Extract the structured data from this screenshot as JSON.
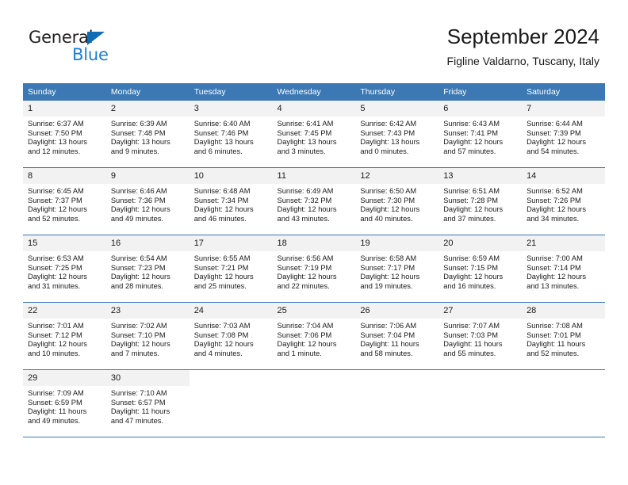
{
  "brand": {
    "name_top": "General",
    "name_bottom": "Blue",
    "triangle_color": "#0f6cb5",
    "blue_text_color": "#1b7fd4"
  },
  "header": {
    "title": "September 2024",
    "subtitle": "Figline Valdarno, Tuscany, Italy"
  },
  "theme": {
    "header_row_bg": "#3b78b4",
    "daynum_bg": "#f2f2f2",
    "border_color": "#3b78b4",
    "text_color": "#1a1a1a"
  },
  "weekday_headers": [
    "Sunday",
    "Monday",
    "Tuesday",
    "Wednesday",
    "Thursday",
    "Friday",
    "Saturday"
  ],
  "labels": {
    "sunrise_prefix": "Sunrise:",
    "sunset_prefix": "Sunset:",
    "daylight_prefix": "Daylight:"
  },
  "weeks": [
    [
      {
        "day": "1",
        "sunrise": "Sunrise: 6:37 AM",
        "sunset": "Sunset: 7:50 PM",
        "daylight_line1": "Daylight: 13 hours",
        "daylight_line2": "and 12 minutes."
      },
      {
        "day": "2",
        "sunrise": "Sunrise: 6:39 AM",
        "sunset": "Sunset: 7:48 PM",
        "daylight_line1": "Daylight: 13 hours",
        "daylight_line2": "and 9 minutes."
      },
      {
        "day": "3",
        "sunrise": "Sunrise: 6:40 AM",
        "sunset": "Sunset: 7:46 PM",
        "daylight_line1": "Daylight: 13 hours",
        "daylight_line2": "and 6 minutes."
      },
      {
        "day": "4",
        "sunrise": "Sunrise: 6:41 AM",
        "sunset": "Sunset: 7:45 PM",
        "daylight_line1": "Daylight: 13 hours",
        "daylight_line2": "and 3 minutes."
      },
      {
        "day": "5",
        "sunrise": "Sunrise: 6:42 AM",
        "sunset": "Sunset: 7:43 PM",
        "daylight_line1": "Daylight: 13 hours",
        "daylight_line2": "and 0 minutes."
      },
      {
        "day": "6",
        "sunrise": "Sunrise: 6:43 AM",
        "sunset": "Sunset: 7:41 PM",
        "daylight_line1": "Daylight: 12 hours",
        "daylight_line2": "and 57 minutes."
      },
      {
        "day": "7",
        "sunrise": "Sunrise: 6:44 AM",
        "sunset": "Sunset: 7:39 PM",
        "daylight_line1": "Daylight: 12 hours",
        "daylight_line2": "and 54 minutes."
      }
    ],
    [
      {
        "day": "8",
        "sunrise": "Sunrise: 6:45 AM",
        "sunset": "Sunset: 7:37 PM",
        "daylight_line1": "Daylight: 12 hours",
        "daylight_line2": "and 52 minutes."
      },
      {
        "day": "9",
        "sunrise": "Sunrise: 6:46 AM",
        "sunset": "Sunset: 7:36 PM",
        "daylight_line1": "Daylight: 12 hours",
        "daylight_line2": "and 49 minutes."
      },
      {
        "day": "10",
        "sunrise": "Sunrise: 6:48 AM",
        "sunset": "Sunset: 7:34 PM",
        "daylight_line1": "Daylight: 12 hours",
        "daylight_line2": "and 46 minutes."
      },
      {
        "day": "11",
        "sunrise": "Sunrise: 6:49 AM",
        "sunset": "Sunset: 7:32 PM",
        "daylight_line1": "Daylight: 12 hours",
        "daylight_line2": "and 43 minutes."
      },
      {
        "day": "12",
        "sunrise": "Sunrise: 6:50 AM",
        "sunset": "Sunset: 7:30 PM",
        "daylight_line1": "Daylight: 12 hours",
        "daylight_line2": "and 40 minutes."
      },
      {
        "day": "13",
        "sunrise": "Sunrise: 6:51 AM",
        "sunset": "Sunset: 7:28 PM",
        "daylight_line1": "Daylight: 12 hours",
        "daylight_line2": "and 37 minutes."
      },
      {
        "day": "14",
        "sunrise": "Sunrise: 6:52 AM",
        "sunset": "Sunset: 7:26 PM",
        "daylight_line1": "Daylight: 12 hours",
        "daylight_line2": "and 34 minutes."
      }
    ],
    [
      {
        "day": "15",
        "sunrise": "Sunrise: 6:53 AM",
        "sunset": "Sunset: 7:25 PM",
        "daylight_line1": "Daylight: 12 hours",
        "daylight_line2": "and 31 minutes."
      },
      {
        "day": "16",
        "sunrise": "Sunrise: 6:54 AM",
        "sunset": "Sunset: 7:23 PM",
        "daylight_line1": "Daylight: 12 hours",
        "daylight_line2": "and 28 minutes."
      },
      {
        "day": "17",
        "sunrise": "Sunrise: 6:55 AM",
        "sunset": "Sunset: 7:21 PM",
        "daylight_line1": "Daylight: 12 hours",
        "daylight_line2": "and 25 minutes."
      },
      {
        "day": "18",
        "sunrise": "Sunrise: 6:56 AM",
        "sunset": "Sunset: 7:19 PM",
        "daylight_line1": "Daylight: 12 hours",
        "daylight_line2": "and 22 minutes."
      },
      {
        "day": "19",
        "sunrise": "Sunrise: 6:58 AM",
        "sunset": "Sunset: 7:17 PM",
        "daylight_line1": "Daylight: 12 hours",
        "daylight_line2": "and 19 minutes."
      },
      {
        "day": "20",
        "sunrise": "Sunrise: 6:59 AM",
        "sunset": "Sunset: 7:15 PM",
        "daylight_line1": "Daylight: 12 hours",
        "daylight_line2": "and 16 minutes."
      },
      {
        "day": "21",
        "sunrise": "Sunrise: 7:00 AM",
        "sunset": "Sunset: 7:14 PM",
        "daylight_line1": "Daylight: 12 hours",
        "daylight_line2": "and 13 minutes."
      }
    ],
    [
      {
        "day": "22",
        "sunrise": "Sunrise: 7:01 AM",
        "sunset": "Sunset: 7:12 PM",
        "daylight_line1": "Daylight: 12 hours",
        "daylight_line2": "and 10 minutes."
      },
      {
        "day": "23",
        "sunrise": "Sunrise: 7:02 AM",
        "sunset": "Sunset: 7:10 PM",
        "daylight_line1": "Daylight: 12 hours",
        "daylight_line2": "and 7 minutes."
      },
      {
        "day": "24",
        "sunrise": "Sunrise: 7:03 AM",
        "sunset": "Sunset: 7:08 PM",
        "daylight_line1": "Daylight: 12 hours",
        "daylight_line2": "and 4 minutes."
      },
      {
        "day": "25",
        "sunrise": "Sunrise: 7:04 AM",
        "sunset": "Sunset: 7:06 PM",
        "daylight_line1": "Daylight: 12 hours",
        "daylight_line2": "and 1 minute."
      },
      {
        "day": "26",
        "sunrise": "Sunrise: 7:06 AM",
        "sunset": "Sunset: 7:04 PM",
        "daylight_line1": "Daylight: 11 hours",
        "daylight_line2": "and 58 minutes."
      },
      {
        "day": "27",
        "sunrise": "Sunrise: 7:07 AM",
        "sunset": "Sunset: 7:03 PM",
        "daylight_line1": "Daylight: 11 hours",
        "daylight_line2": "and 55 minutes."
      },
      {
        "day": "28",
        "sunrise": "Sunrise: 7:08 AM",
        "sunset": "Sunset: 7:01 PM",
        "daylight_line1": "Daylight: 11 hours",
        "daylight_line2": "and 52 minutes."
      }
    ],
    [
      {
        "day": "29",
        "sunrise": "Sunrise: 7:09 AM",
        "sunset": "Sunset: 6:59 PM",
        "daylight_line1": "Daylight: 11 hours",
        "daylight_line2": "and 49 minutes."
      },
      {
        "day": "30",
        "sunrise": "Sunrise: 7:10 AM",
        "sunset": "Sunset: 6:57 PM",
        "daylight_line1": "Daylight: 11 hours",
        "daylight_line2": "and 47 minutes."
      },
      {
        "day": "",
        "sunrise": "",
        "sunset": "",
        "daylight_line1": "",
        "daylight_line2": ""
      },
      {
        "day": "",
        "sunrise": "",
        "sunset": "",
        "daylight_line1": "",
        "daylight_line2": ""
      },
      {
        "day": "",
        "sunrise": "",
        "sunset": "",
        "daylight_line1": "",
        "daylight_line2": ""
      },
      {
        "day": "",
        "sunrise": "",
        "sunset": "",
        "daylight_line1": "",
        "daylight_line2": ""
      },
      {
        "day": "",
        "sunrise": "",
        "sunset": "",
        "daylight_line1": "",
        "daylight_line2": ""
      }
    ]
  ]
}
